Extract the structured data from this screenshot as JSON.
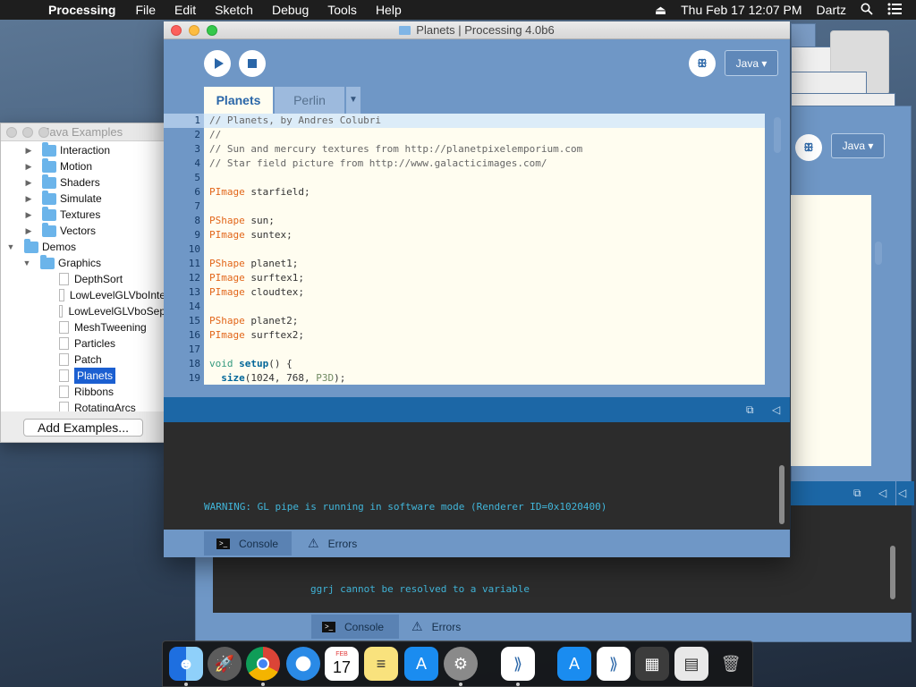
{
  "menubar": {
    "app_name": "Processing",
    "items": [
      "File",
      "Edit",
      "Sketch",
      "Debug",
      "Tools",
      "Help"
    ],
    "clock": "Thu Feb 17  12:07 PM",
    "user": "Dartz"
  },
  "examples_window": {
    "title": "Java Examples",
    "tree": [
      {
        "label": "Interaction",
        "type": "folder",
        "expanded": false
      },
      {
        "label": "Motion",
        "type": "folder",
        "expanded": false
      },
      {
        "label": "Shaders",
        "type": "folder",
        "expanded": false
      },
      {
        "label": "Simulate",
        "type": "folder",
        "expanded": false
      },
      {
        "label": "Textures",
        "type": "folder",
        "expanded": false
      },
      {
        "label": "Vectors",
        "type": "folder",
        "expanded": false
      },
      {
        "label": "Demos",
        "type": "folder",
        "expanded": true
      },
      {
        "label": "Graphics",
        "type": "folder",
        "expanded": true
      },
      {
        "label": "DepthSort",
        "type": "file"
      },
      {
        "label": "LowLevelGLVboInte",
        "type": "file"
      },
      {
        "label": "LowLevelGLVboSep",
        "type": "file"
      },
      {
        "label": "MeshTweening",
        "type": "file"
      },
      {
        "label": "Particles",
        "type": "file"
      },
      {
        "label": "Patch",
        "type": "file"
      },
      {
        "label": "Planets",
        "type": "file",
        "selected": true
      },
      {
        "label": "Ribbons",
        "type": "file"
      },
      {
        "label": "RotatingArcs",
        "type": "file"
      }
    ],
    "add_button": "Add Examples..."
  },
  "main_window": {
    "title": "Planets | Processing 4.0b6",
    "mode": "Java ▾",
    "tabs": [
      {
        "label": "Planets",
        "active": true
      },
      {
        "label": "Perlin",
        "active": false
      }
    ],
    "tab_menu": "▼",
    "current_line": 1,
    "code": [
      "// Planets, by Andres Colubri",
      "//",
      "// Sun and mercury textures from http://planetpixelemporium.com",
      "// Star field picture from http://www.galacticimages.com/",
      "",
      "PImage starfield;",
      "",
      "PShape sun;",
      "PImage suntex;",
      "",
      "PShape planet1;",
      "PImage surftex1;",
      "PImage cloudtex;",
      "",
      "PShape planet2;",
      "PImage surftex2;",
      "",
      "void setup() {",
      "  size(1024, 768, P3D);"
    ],
    "console_message": "WARNING: GL pipe is running in software mode (Renderer ID=0x1020400)",
    "console_tab": "Console",
    "errors_tab": "Errors"
  },
  "behind_window": {
    "mode": "Java ▾",
    "console_message": "ggrj cannot be resolved to a variable",
    "console_tab": "Console",
    "errors_tab": "Errors"
  },
  "dock": {
    "calendar_month": "FEB",
    "calendar_day": "17"
  },
  "colors": {
    "processing_blue": "#6f97c6",
    "editor_bg": "#fffdf0",
    "console_text": "#41b5d9",
    "type_keyword": "#e2661a",
    "selection": "#1b5fd1"
  }
}
